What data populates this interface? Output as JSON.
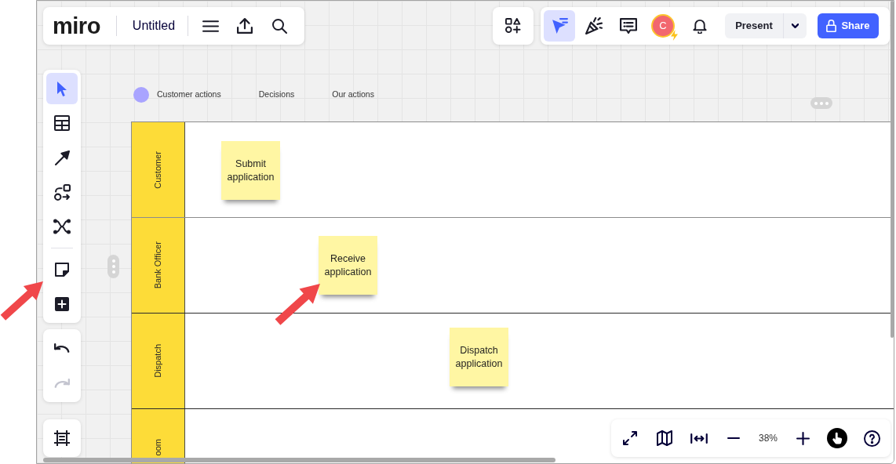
{
  "board_menu": {
    "logo": "miro",
    "title": "Untitled"
  },
  "collaboration_toolbar": {
    "tools": [
      {
        "kind": "cursor",
        "selected": true
      },
      {
        "kind": "party_popper",
        "selected": false
      },
      {
        "kind": "comment",
        "selected": false
      }
    ],
    "avatar": {
      "initial": "C"
    },
    "present": {
      "label": "Present"
    },
    "share": {
      "label": "Share"
    }
  },
  "left_toolbar": {
    "tools": [
      {
        "kind": "select",
        "selected": true
      },
      {
        "kind": "table",
        "selected": false
      },
      {
        "kind": "line",
        "selected": false
      },
      {
        "kind": "diagram",
        "selected": false
      },
      {
        "kind": "mind_map",
        "selected": false
      },
      {
        "kind": "sticky_note",
        "selected": false
      },
      {
        "kind": "add",
        "selected": false
      }
    ],
    "history": [
      {
        "kind": "undo",
        "disabled": false
      },
      {
        "kind": "redo",
        "disabled": true
      }
    ]
  },
  "legend": [
    {
      "label": "Customer actions",
      "color": "#a9a4ff"
    },
    {
      "label": "Decisions"
    },
    {
      "label": "Our actions"
    }
  ],
  "swimlanes": {
    "lanes": [
      {
        "label": "Customer",
        "notes": [
          "Submit application"
        ]
      },
      {
        "label": "Bank Officer",
        "notes": [
          "Receive application"
        ]
      },
      {
        "label": "Dispatch",
        "notes": [
          "Dispatch application"
        ]
      },
      {
        "label": "oom"
      }
    ]
  },
  "zoom_controls": {
    "zoom_level": "38%"
  }
}
